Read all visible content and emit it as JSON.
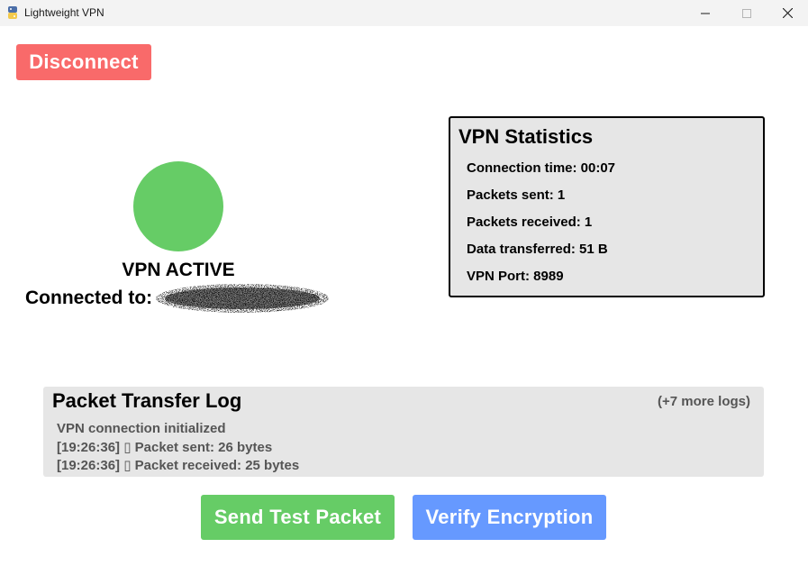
{
  "window": {
    "title": "Lightweight VPN",
    "controls": {
      "minimize_icon": "minimize-icon",
      "maximize_icon": "maximize-icon",
      "close_icon": "close-icon"
    }
  },
  "toolbar": {
    "disconnect_label": "Disconnect"
  },
  "status": {
    "text": "VPN ACTIVE",
    "connected_label": "Connected to:",
    "color": "#66cc66"
  },
  "stats": {
    "title": "VPN Statistics",
    "items": [
      "Connection time: 00:07",
      "Packets sent: 1",
      "Packets received: 1",
      "Data transferred: 51 B",
      "VPN Port: 8989"
    ]
  },
  "log": {
    "title": "Packet Transfer Log",
    "more": "(+7 more logs)",
    "lines": [
      "VPN connection initialized",
      "[19:26:36] ▯ Packet sent: 26 bytes",
      "[19:26:36] ▯ Packet received: 25 bytes"
    ]
  },
  "actions": {
    "send_label": "Send Test Packet",
    "verify_label": "Verify Encryption"
  },
  "colors": {
    "disconnect": "#f96a6a",
    "send": "#66cc66",
    "verify": "#6699ff",
    "panel": "#e6e6e6"
  }
}
